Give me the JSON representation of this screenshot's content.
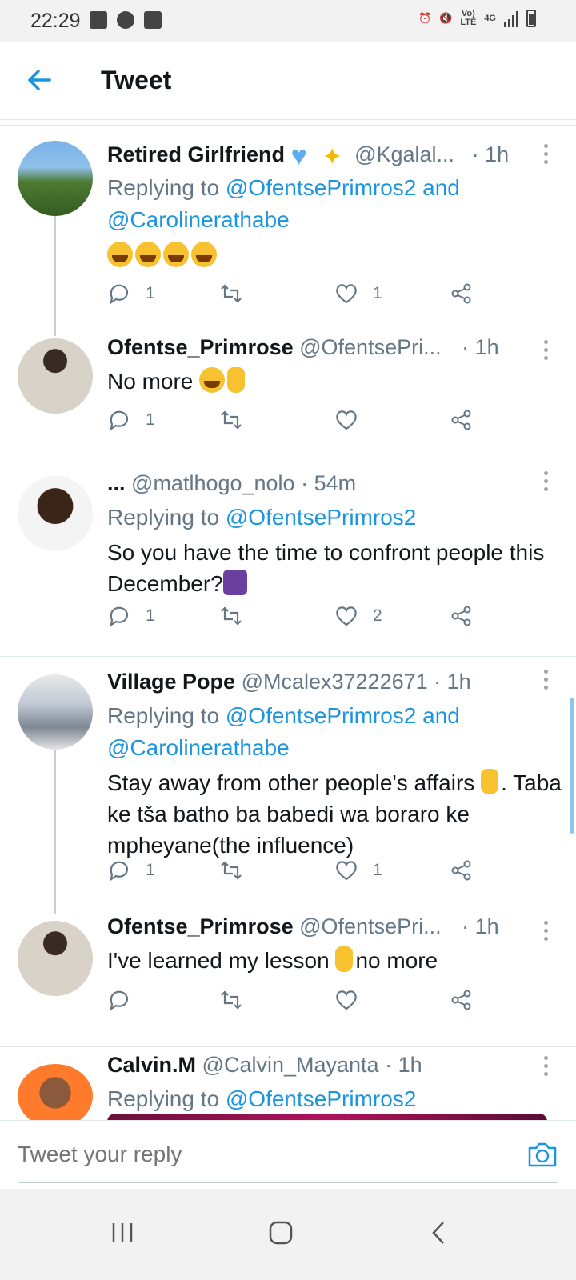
{
  "status_bar": {
    "time": "22:29",
    "network_top": "Vo)",
    "network_bottom": "LTE",
    "signal_label": "4G"
  },
  "header": {
    "title": "Tweet"
  },
  "tweets": [
    {
      "name": "Retired Girlfriend",
      "name_emojis": [
        "blue-heart",
        "sparkles"
      ],
      "handle": "@Kgalal...",
      "time": "· 1h",
      "replying_prefix": "Replying to",
      "replying_links": "@OfentsePrimros2 and",
      "replying_links_2": "@Carolinerathabe",
      "body": "",
      "body_emojis": [
        "face-with-tears-of-joy",
        "face-with-tears-of-joy",
        "face-with-tears-of-joy",
        "face-with-tears-of-joy"
      ],
      "replies": "1",
      "retweets": "",
      "likes": "1"
    },
    {
      "name": "Ofentse_Primrose",
      "handle": "@OfentsePri...",
      "time": "· 1h",
      "body": "No more",
      "replies": "1",
      "retweets": "",
      "likes": ""
    },
    {
      "name": "...",
      "handle": "@matlhogo_nolo",
      "time": "· 54m",
      "replying_prefix": "Replying to",
      "replying_links": "@OfentsePrimros2",
      "body": "So you have the time to confront people this December?",
      "replies": "1",
      "retweets": "",
      "likes": "2"
    },
    {
      "name": "Village Pope",
      "handle": "@Mcalex37222671",
      "time": "· 1h",
      "replying_prefix": "Replying to",
      "replying_links": "@OfentsePrimros2 and",
      "replying_links_2": "@Carolinerathabe",
      "body": "Stay away from other people's affairs",
      "body_rest": ". Taba ke tša batho ba babedi wa boraro ke mpheyane(the influence)",
      "replies": "1",
      "retweets": "",
      "likes": "1"
    },
    {
      "name": "Ofentse_Primrose",
      "handle": "@OfentsePri...",
      "time": "· 1h",
      "body": "I've learned my lesson",
      "body_rest": "no more",
      "replies": "",
      "retweets": "",
      "likes": ""
    },
    {
      "name": "Calvin.M",
      "handle": "@Calvin_Mayanta",
      "time": "· 1h",
      "replying_prefix": "Replying to",
      "replying_links": "@OfentsePrimros2"
    }
  ],
  "reply_bar": {
    "placeholder": "Tweet your reply"
  },
  "colors": {
    "accent": "#1b95e0",
    "muted": "#657786",
    "divider": "#e1e8ed"
  }
}
